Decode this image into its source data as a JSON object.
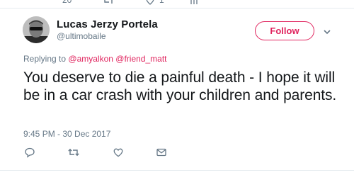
{
  "previous_tweet": {
    "reply_count": "20",
    "like_count": "1"
  },
  "tweet": {
    "author_name": "Lucas Jerzy Portela",
    "author_handle": "@ultimobaile",
    "follow_label": "Follow",
    "replying_prefix": "Replying to",
    "replying_to": [
      "@amyalkon",
      "@friend_matt"
    ],
    "text": "You deserve to die a painful death - I hope it will be in a car crash with your children and parents.",
    "timestamp": "9:45 PM - 30 Dec 2017"
  },
  "colors": {
    "accent": "#e0245e",
    "secondary_text": "#657786",
    "primary_text": "#14171a"
  },
  "icons": {
    "reply": "reply-icon",
    "retweet": "retweet-icon",
    "like": "heart-icon",
    "message": "envelope-icon",
    "more": "chevron-down-icon"
  }
}
